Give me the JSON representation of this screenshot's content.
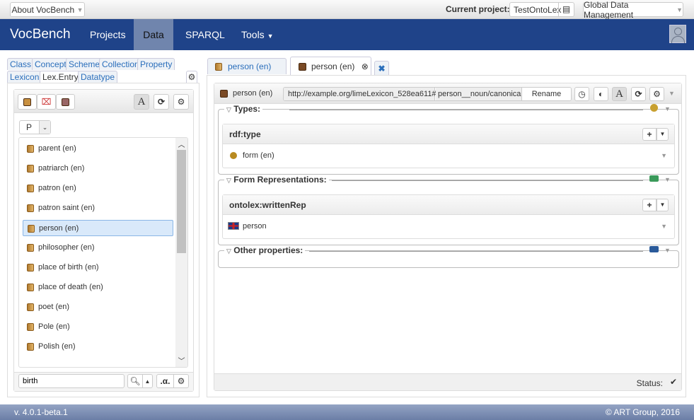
{
  "topbar": {
    "about": "About VocBench",
    "current_project_label": "Current project:",
    "project": "TestOntoLex",
    "global": "Global Data Management"
  },
  "navbar": {
    "brand": "VocBench",
    "items": [
      "Projects",
      "Data",
      "SPARQL",
      "Tools"
    ],
    "active": "Data"
  },
  "left": {
    "tabs_row1": [
      "Class",
      "Concept",
      "Scheme",
      "Collection",
      "Property"
    ],
    "tabs_row2": [
      "Lexicon",
      "Lex.Entry",
      "Datatype"
    ],
    "active_tab": "Lex.Entry",
    "index_letter": "P",
    "items": [
      "parent (en)",
      "patriarch (en)",
      "patron (en)",
      "patron saint (en)",
      "person (en)",
      "philosopher (en)",
      "place of birth (en)",
      "place of death (en)",
      "poet (en)",
      "Pole (en)",
      "Polish (en)"
    ],
    "selected": "person (en)",
    "search_value": "birth",
    "alpha_label": ".α."
  },
  "right": {
    "tabs": [
      {
        "label": "person (en)",
        "active": false
      },
      {
        "label": "person (en)",
        "active": true
      }
    ],
    "header": {
      "title": "person (en)",
      "namespace": "http://example.org/limeLexicon_528ea611#",
      "localname": "person__noun/canonical",
      "rename": "Rename"
    },
    "sections": [
      {
        "title": "Types:",
        "property": "rdf:type",
        "value": "form (en)"
      },
      {
        "title": "Form Representations:",
        "property": "ontolex:writtenRep",
        "value": "person"
      },
      {
        "title": "Other properties:"
      }
    ],
    "status_label": "Status:"
  },
  "footer": {
    "version": "v. 4.0.1-beta.1",
    "copyright": "© ART Group, 2016"
  },
  "colors": {
    "navbar": "#1f4389",
    "nav_active": "#7085ad",
    "link": "#2a6ebb",
    "selected_bg": "#d9e9fa"
  }
}
